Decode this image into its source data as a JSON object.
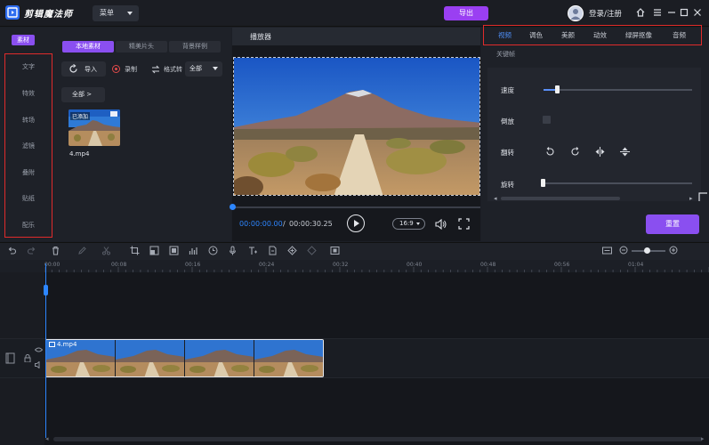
{
  "app": {
    "title": "剪辑魔法师",
    "menu_label": "菜单",
    "export_label": "导出",
    "login_label": "登录/注册"
  },
  "left": {
    "active_category": "素材",
    "nav": [
      "文字",
      "特效",
      "转场",
      "滤镜",
      "叠附",
      "贴纸",
      "配乐"
    ],
    "sub_tabs": [
      "本地素材",
      "精美片头",
      "背景样例"
    ],
    "import_label": "导入",
    "record_label": "录制",
    "format_label": "格式转",
    "format_value": "全部",
    "filter_label": "全部 >",
    "media": {
      "name": "4.mp4",
      "status": "已添加"
    }
  },
  "player": {
    "title": "播放器",
    "current_time": "00:00:00.00",
    "separator": "/",
    "total_time": "00:00:30.25",
    "ratio": "16:9",
    "progress": 0
  },
  "props": {
    "tabs": [
      "视频",
      "调色",
      "美颜",
      "动效",
      "绿屏抠像",
      "音频"
    ],
    "active_tab": "视频",
    "keyframe_label": "关键帧",
    "speed_label": "速度",
    "reverse_label": "倒放",
    "flip_label": "翻转",
    "rotate_label": "旋转",
    "reset_label": "重置",
    "speed_level": 0.09,
    "rotate_level": 0
  },
  "timeline": {
    "ticks": [
      "00:00",
      "00:08",
      "00:16",
      "00:24",
      "00:32",
      "00:40",
      "00:48",
      "00:56",
      "01:04"
    ],
    "clip_name": "4.mp4",
    "zoom_level": 0.45
  },
  "colors": {
    "accent_purple": "#8a4ff0",
    "accent_blue": "#2d86ff",
    "highlight_red": "#e02b2b",
    "export_purple": "#9a3ff2"
  }
}
